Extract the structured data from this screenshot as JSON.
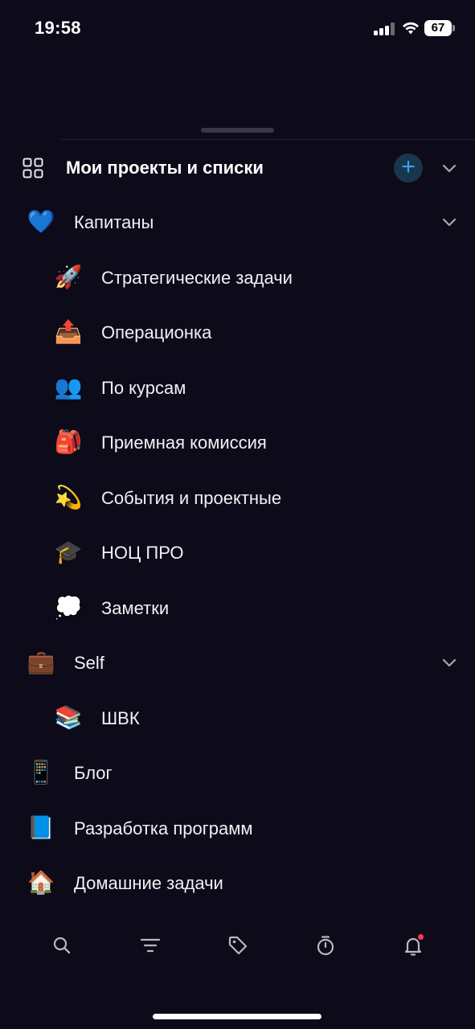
{
  "status_bar": {
    "time": "19:58",
    "battery": "67"
  },
  "header": {
    "title": "Мои проекты и списки",
    "add_label": "+"
  },
  "items": [
    {
      "emoji": "💙",
      "label": "Капитаны",
      "level": 0,
      "expandable": true
    },
    {
      "emoji": "🚀",
      "label": "Стратегические задачи",
      "level": 1
    },
    {
      "emoji": "📤",
      "label": "Операционка",
      "level": 1
    },
    {
      "emoji": "👥",
      "label": "По курсам",
      "level": 1
    },
    {
      "emoji": "🎒",
      "label": "Приемная комиссия",
      "level": 1
    },
    {
      "emoji": "💫",
      "label": "События и проектные",
      "level": 1
    },
    {
      "emoji": "🎓",
      "label": "НОЦ ПРО",
      "level": 1
    },
    {
      "emoji": "💭",
      "label": "Заметки",
      "level": 1
    },
    {
      "emoji": "💼",
      "label": "Self",
      "level": 0,
      "expandable": true
    },
    {
      "emoji": "📚",
      "label": "ШВК",
      "level": 1
    },
    {
      "emoji": "📱",
      "label": "Блог",
      "level": 0
    },
    {
      "emoji": "📘",
      "label": "Разработка программ",
      "level": 0
    },
    {
      "emoji": "🏠",
      "label": "Домашние задачи",
      "level": 0
    }
  ],
  "tabbar": {
    "icons": [
      "search-icon",
      "filter-icon",
      "tag-icon",
      "timer-icon",
      "bell-icon"
    ]
  },
  "colors": {
    "background": "#0d0a1a",
    "accent": "#3ea0ee",
    "accent_bg": "#17374f",
    "notification": "#ff3b4a"
  }
}
